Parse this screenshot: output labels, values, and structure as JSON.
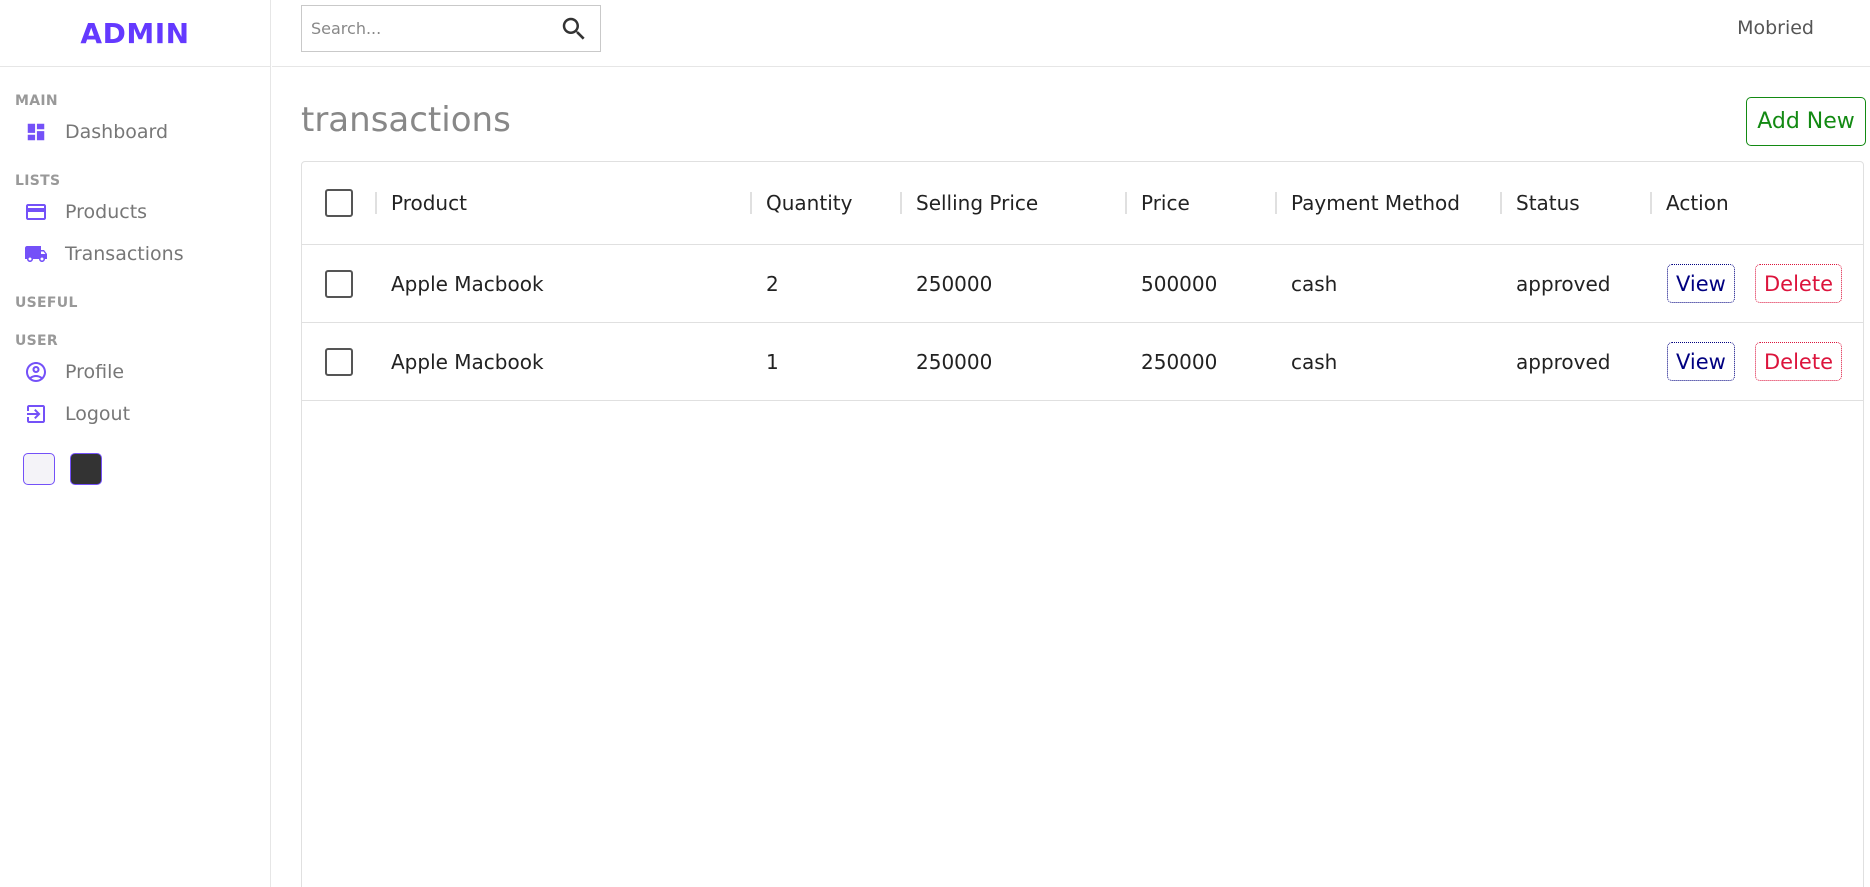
{
  "brand": {
    "logo": "ADMIN",
    "accent": "#6439ff"
  },
  "search": {
    "placeholder": "Search..."
  },
  "user": {
    "name": "Mobried"
  },
  "sidebar": {
    "sections": {
      "main": "MAIN",
      "lists": "LISTS",
      "useful": "USEFUL",
      "user": "USER"
    },
    "items": [
      {
        "label": "Dashboard",
        "icon": "dashboard-icon"
      },
      {
        "label": "Products",
        "icon": "credit-card-icon"
      },
      {
        "label": "Transactions",
        "icon": "truck-icon"
      },
      {
        "label": "Profile",
        "icon": "account-circle-icon"
      },
      {
        "label": "Logout",
        "icon": "logout-icon"
      }
    ],
    "themes": [
      {
        "name": "light",
        "color": "#f4f3f8"
      },
      {
        "name": "dark",
        "color": "#333333"
      }
    ]
  },
  "page": {
    "title": "transactions",
    "add_new_label": "Add New"
  },
  "table": {
    "columns": [
      "Product",
      "Quantity",
      "Selling Price",
      "Price",
      "Payment Method",
      "Status",
      "Action"
    ],
    "rows": [
      {
        "product": "Apple Macbook",
        "quantity": "2",
        "selling_price": "250000",
        "price": "500000",
        "payment_method": "cash",
        "status": "approved",
        "view_label": "View",
        "delete_label": "Delete"
      },
      {
        "product": "Apple Macbook",
        "quantity": "1",
        "selling_price": "250000",
        "price": "250000",
        "payment_method": "cash",
        "status": "approved",
        "view_label": "View",
        "delete_label": "Delete"
      }
    ]
  }
}
